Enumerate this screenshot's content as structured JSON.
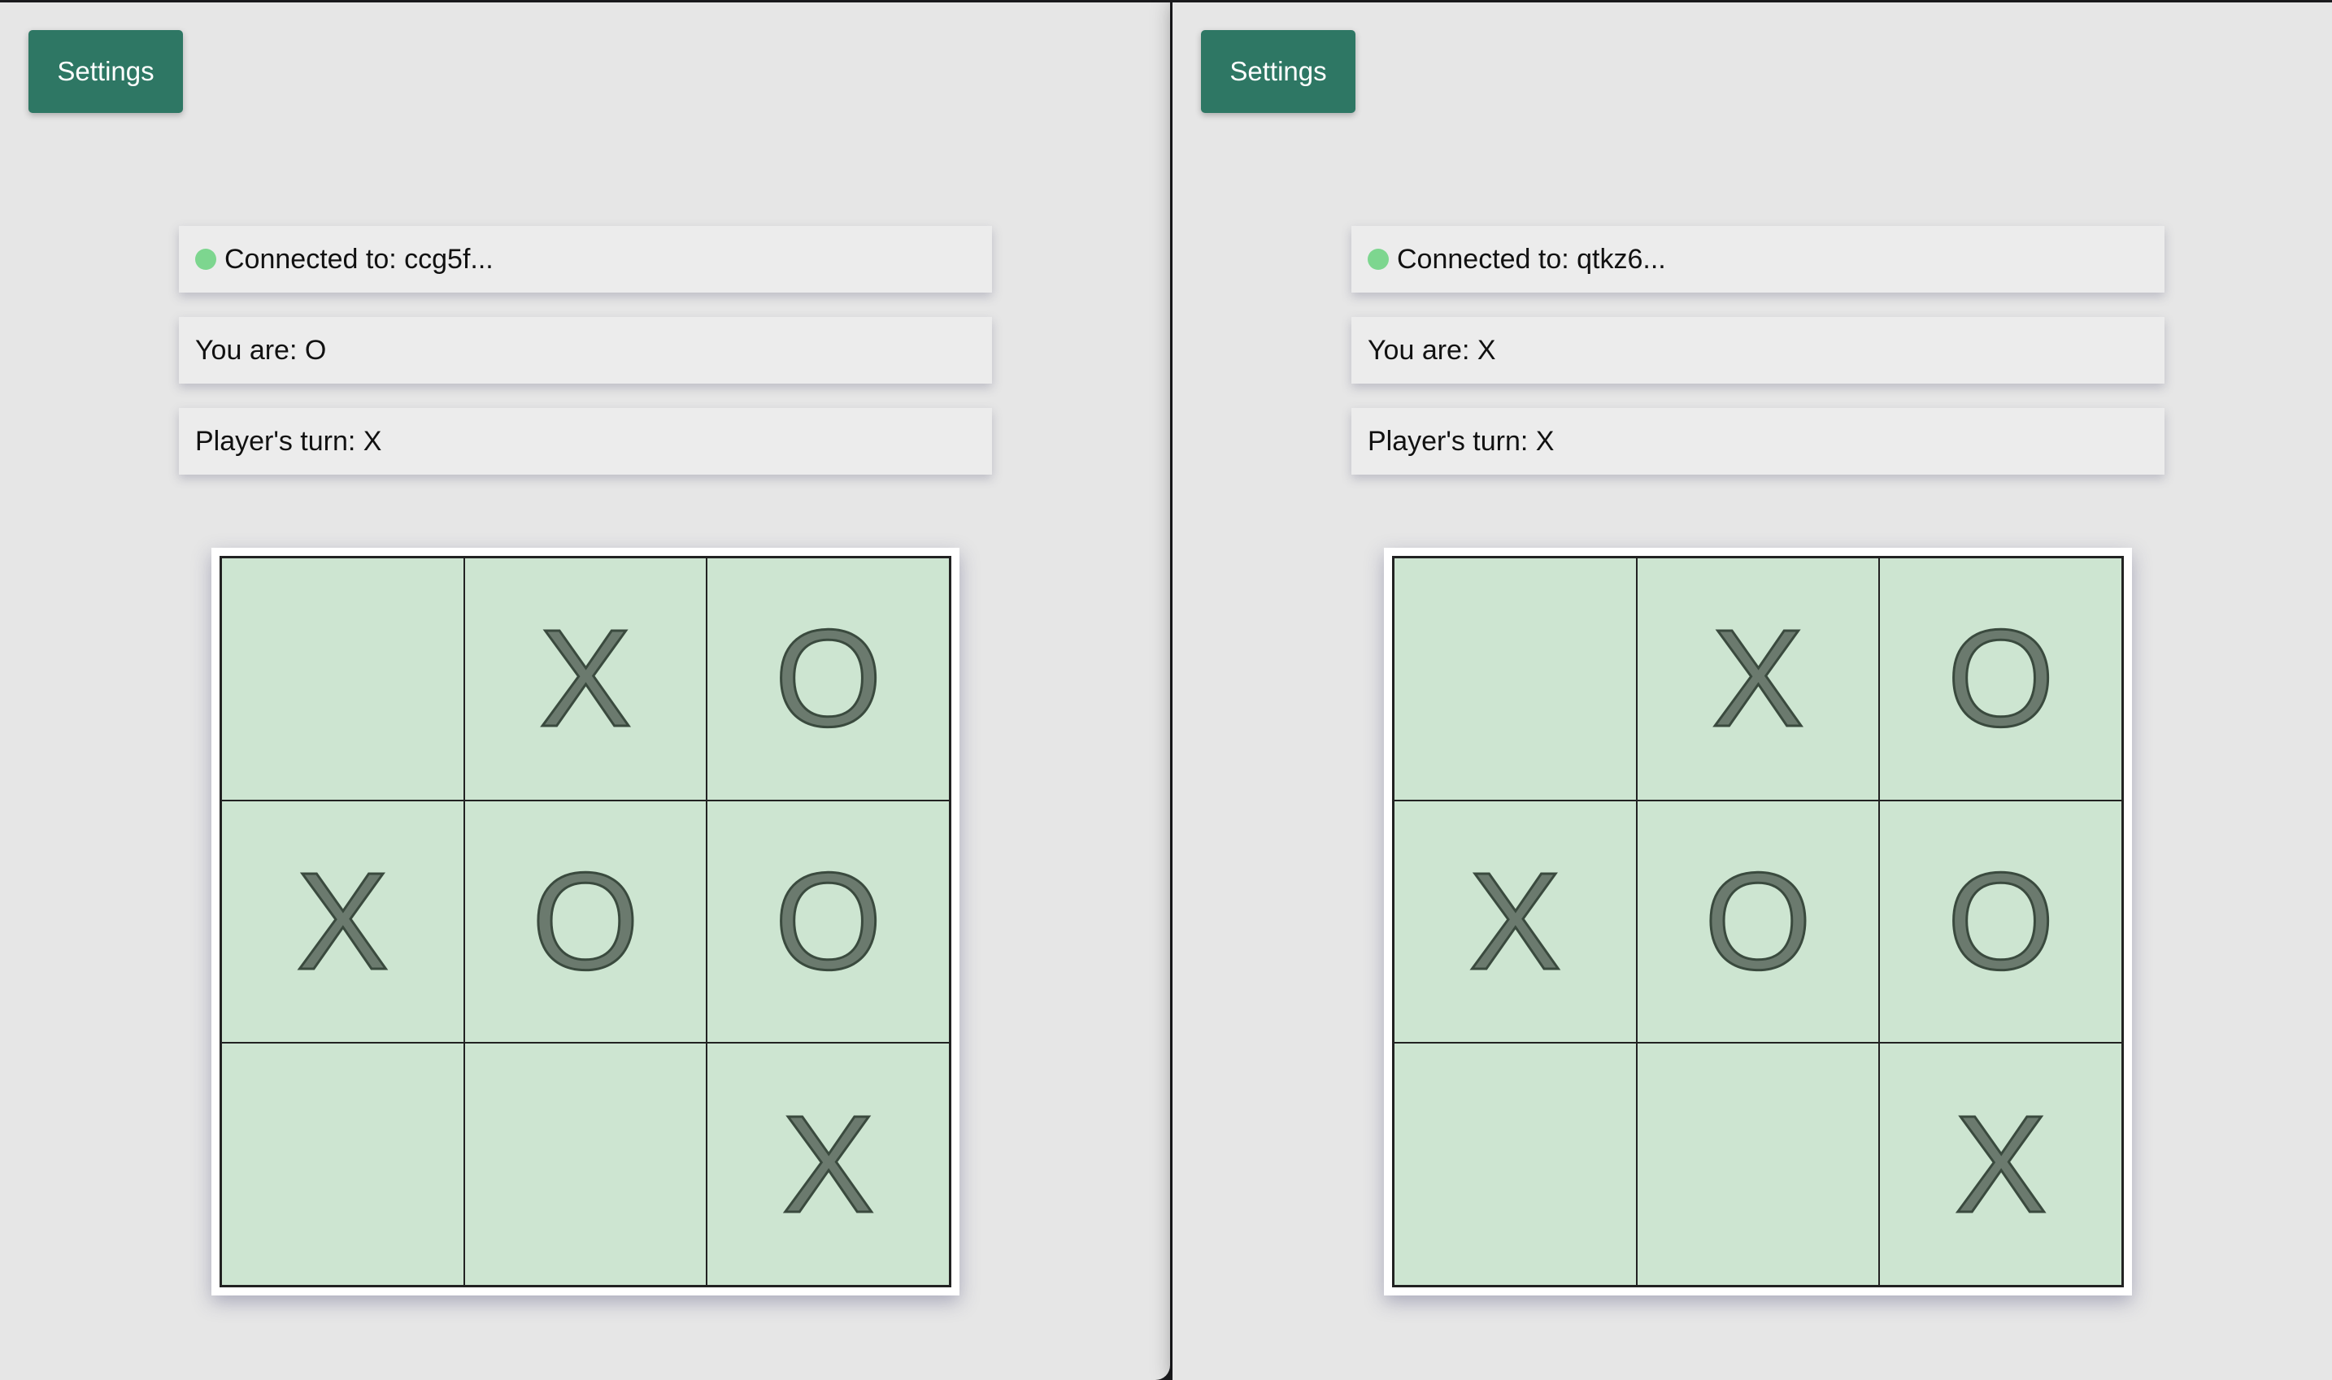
{
  "colors": {
    "status_dot": "#7dd68f",
    "settings_bg": "#2e7764",
    "cell_bg": "#cde5d1"
  },
  "left": {
    "settings_label": "Settings",
    "connected_text": "Connected to: ccg5f...",
    "player_text": "You are: O",
    "turn_text": "Player's turn: X",
    "board": [
      "",
      "X",
      "O",
      "X",
      "O",
      "O",
      "",
      "",
      "X"
    ]
  },
  "right": {
    "settings_label": "Settings",
    "connected_text": "Connected to: qtkz6...",
    "player_text": "You are: X",
    "turn_text": "Player's turn: X",
    "board": [
      "",
      "X",
      "O",
      "X",
      "O",
      "O",
      "",
      "",
      "X"
    ]
  }
}
